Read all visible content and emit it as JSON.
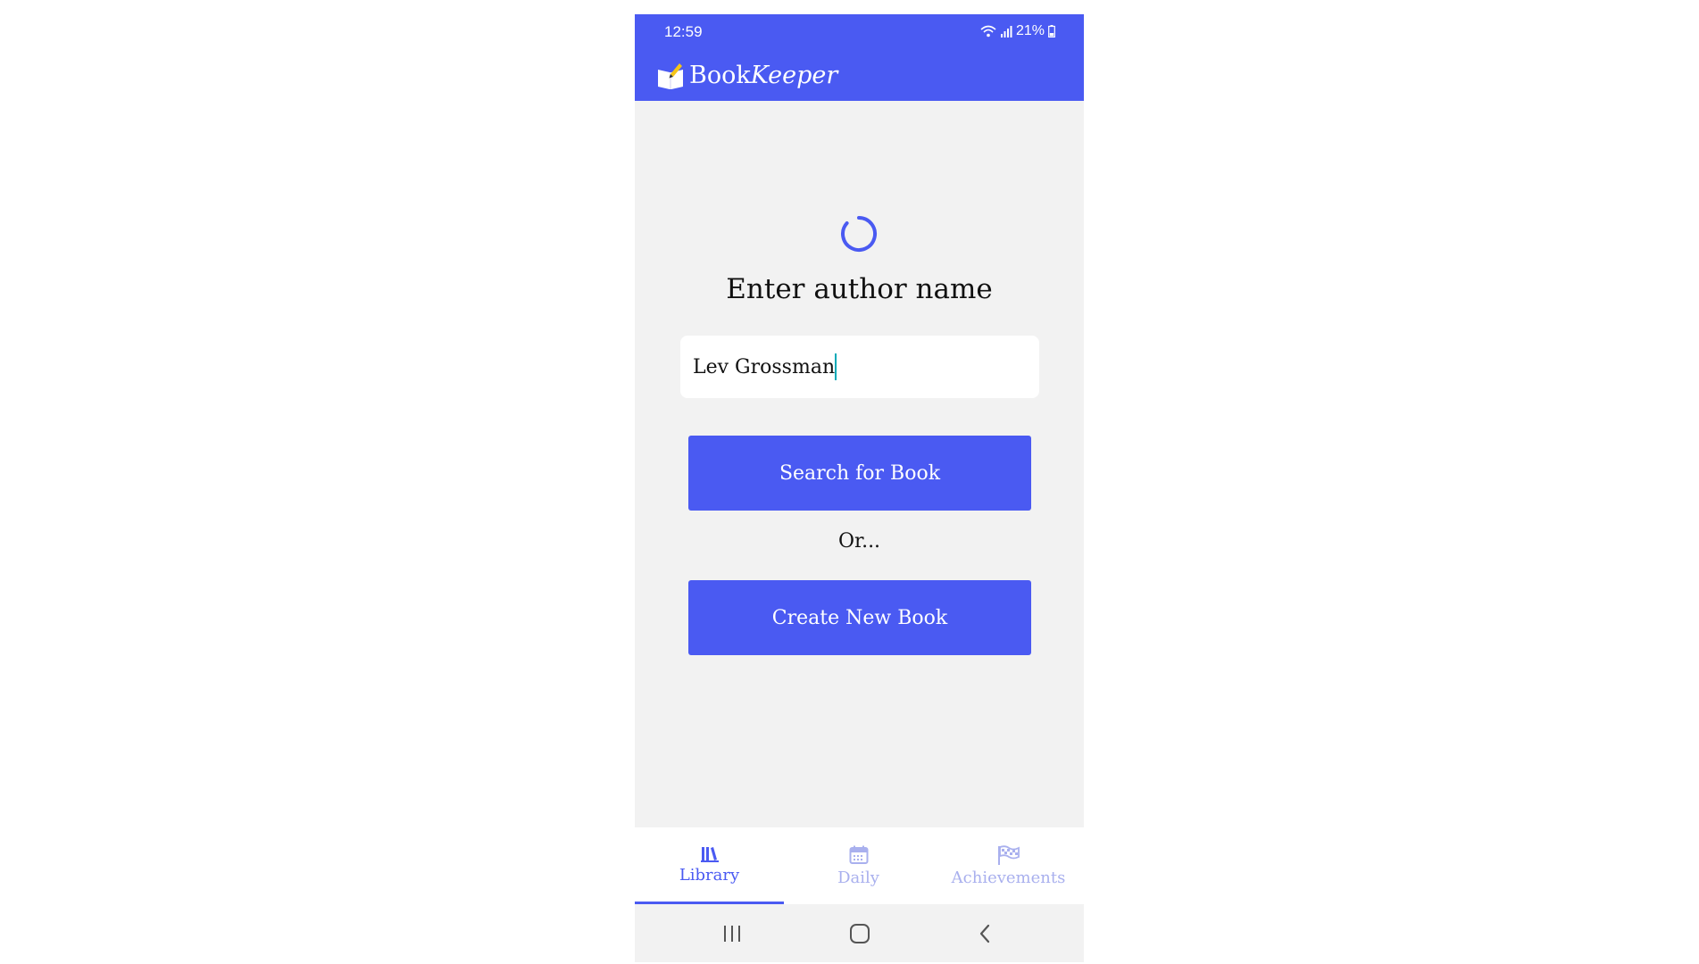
{
  "status_bar": {
    "time": "12:59",
    "battery": "21%"
  },
  "app_bar": {
    "brand_regular": "Book",
    "brand_italic": "Keeper",
    "logo_icon": "book-pencil-icon"
  },
  "search": {
    "heading": "Enter author name",
    "input_value": "Lev Grossman",
    "search_button": "Search for Book",
    "or_text": "Or...",
    "create_button": "Create New Book",
    "loading": true
  },
  "tabs": [
    {
      "label": "Library",
      "icon": "library-icon",
      "active": true
    },
    {
      "label": "Daily",
      "icon": "calendar-icon",
      "active": false
    },
    {
      "label": "Achievements",
      "icon": "checkered-flag-icon",
      "active": false
    }
  ],
  "nav": {
    "icons": [
      "recent-apps-icon",
      "home-icon",
      "back-icon"
    ]
  },
  "colors": {
    "primary": "#4a5af2",
    "background": "#f2f2f2",
    "inactive_tab": "#a9b0ee",
    "caret": "#00a9b7"
  }
}
